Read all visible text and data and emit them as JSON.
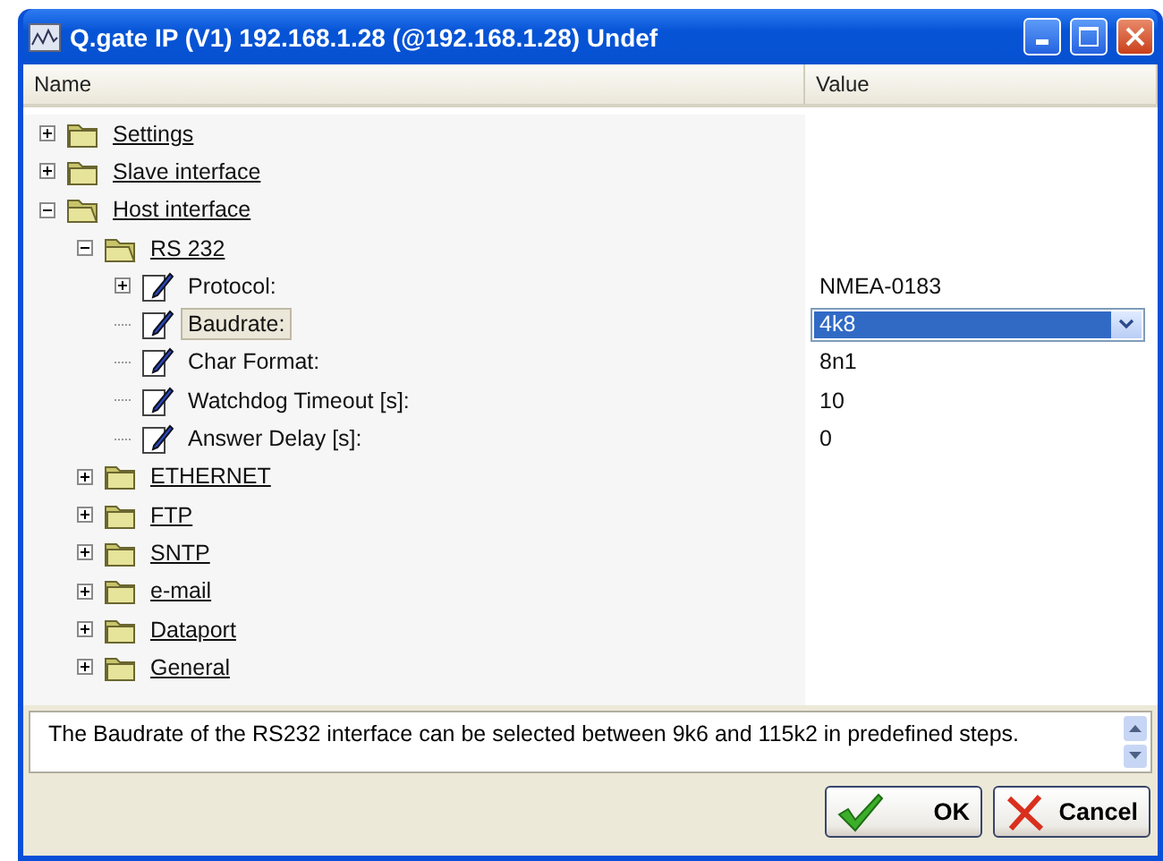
{
  "window": {
    "title": "Q.gate IP (V1) 192.168.1.28 (@192.168.1.28) Undef"
  },
  "columns": [
    "Name",
    "Value"
  ],
  "tree": [
    {
      "kind": "folder",
      "label": "Settings",
      "expanded": false,
      "selected": false
    },
    {
      "kind": "folder",
      "label": "Slave interface",
      "expanded": false,
      "selected": false
    },
    {
      "kind": "folder",
      "label": "Host interface",
      "expanded": true,
      "selected": false,
      "children": [
        {
          "kind": "folder",
          "label": "RS 232",
          "expanded": true,
          "selected": false,
          "children": [
            {
              "kind": "setting",
              "label": "Protocol:",
              "value": "NMEA-0183",
              "expanded": false,
              "selected": false
            },
            {
              "kind": "setting",
              "label": "Baudrate:",
              "value": "4k8",
              "selected": true
            },
            {
              "kind": "setting",
              "label": "Char Format:",
              "value": "8n1",
              "selected": false
            },
            {
              "kind": "setting",
              "label": "Watchdog Timeout [s]:",
              "value": "10",
              "selected": false
            },
            {
              "kind": "setting",
              "label": "Answer Delay [s]:",
              "value": "0",
              "selected": false
            }
          ]
        },
        {
          "kind": "folder",
          "label": "ETHERNET",
          "expanded": false,
          "selected": false
        },
        {
          "kind": "folder",
          "label": "FTP",
          "expanded": false,
          "selected": false
        },
        {
          "kind": "folder",
          "label": "SNTP",
          "expanded": false,
          "selected": false
        },
        {
          "kind": "folder",
          "label": "e-mail",
          "expanded": false,
          "selected": false
        },
        {
          "kind": "folder",
          "label": "Dataport",
          "expanded": false,
          "selected": false
        },
        {
          "kind": "folder",
          "label": "General",
          "expanded": false,
          "selected": false
        }
      ]
    }
  ],
  "description": "The Baudrate of the RS232 interface can be selected between 9k6 and 115k2 in predefined steps.",
  "buttons": [
    {
      "kind": "ok",
      "label": "OK"
    },
    {
      "kind": "cancel",
      "label": "Cancel"
    }
  ]
}
